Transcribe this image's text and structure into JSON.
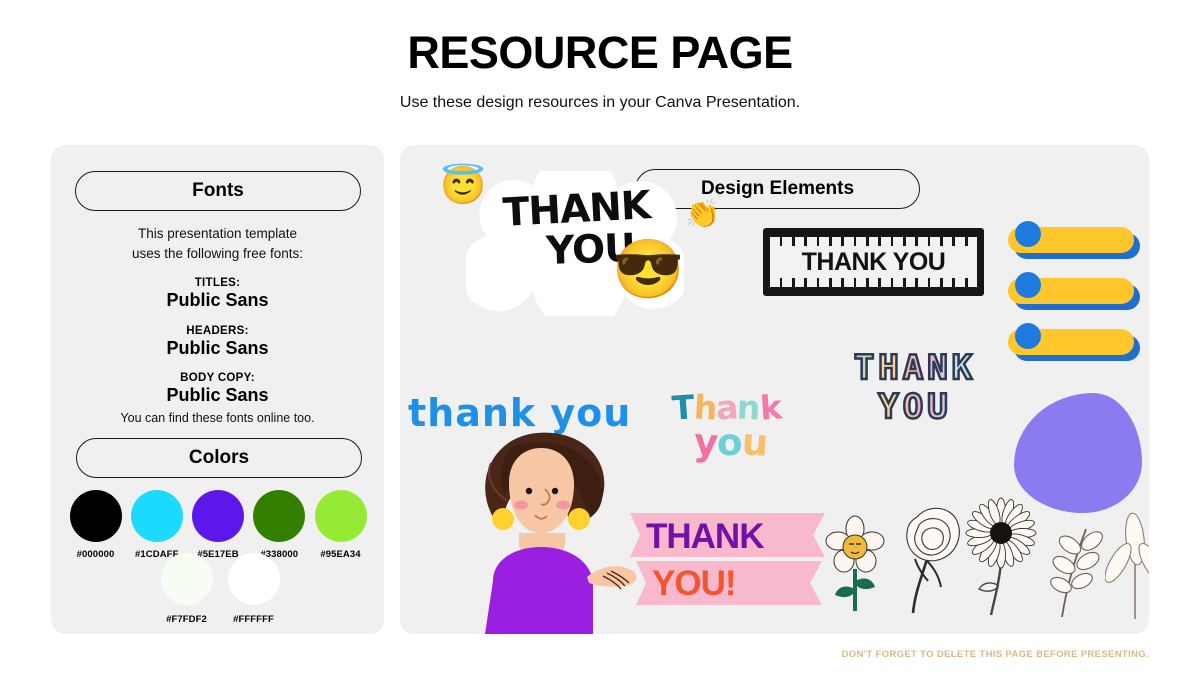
{
  "header": {
    "title": "RESOURCE PAGE",
    "subtitle": "Use these design resources in your Canva Presentation."
  },
  "fonts_panel": {
    "pill_label": "Fonts",
    "intro": "This presentation template\nuses the following free fonts:",
    "groups": [
      {
        "kicker": "TITLES:",
        "font_name": "Public Sans"
      },
      {
        "kicker": "HEADERS:",
        "font_name": "Public Sans"
      },
      {
        "kicker": "BODY COPY:",
        "font_name": "Public Sans"
      }
    ],
    "footer": "You can find these fonts online too."
  },
  "colors_section": {
    "pill_label": "Colors",
    "row1": [
      {
        "hex": "#000000",
        "label": "#000000"
      },
      {
        "hex": "#1CDAFF",
        "label": "#1CDAFF"
      },
      {
        "hex": "#5E17EB",
        "label": "#5E17EB"
      },
      {
        "hex": "#338000",
        "label": "#338000"
      },
      {
        "hex": "#95EA34",
        "label": "#95EA34"
      }
    ],
    "row2": [
      {
        "hex": "#F7FDF2",
        "label": "#F7FDF2"
      },
      {
        "hex": "#FFFFFF",
        "label": "#FFFFFF"
      }
    ]
  },
  "elements_panel": {
    "pill_label": "Design Elements",
    "cloud_sticker": {
      "line1": "THANK",
      "line2": "YOU",
      "emoji_halo": "😇",
      "emoji_clap": "👏",
      "emoji_cool": "😎"
    },
    "film_strip": {
      "text": "THANK YOU"
    },
    "yellow_bars": {
      "count": 3,
      "bar_color": "#FFC72C",
      "dot_color": "#1F7AE0",
      "shadow_color": "#1F6FD0"
    },
    "pixel_text": {
      "line1": "THANK",
      "line2": "YOU"
    },
    "blue_script": {
      "text": "thank you",
      "color": "#1F90E8"
    },
    "pastel_text": {
      "row1": [
        {
          "char": "T",
          "color": "#1D8FA8"
        },
        {
          "char": "h",
          "color": "#F7B45C"
        },
        {
          "char": "a",
          "color": "#F2A8B8"
        },
        {
          "char": "n",
          "color": "#8FD8CF"
        },
        {
          "char": "k",
          "color": "#F27AA8"
        }
      ],
      "row2": [
        {
          "char": "y",
          "color": "#F26FA0"
        },
        {
          "char": "o",
          "color": "#6FCFD8"
        },
        {
          "char": "u",
          "color": "#F5C26B"
        }
      ]
    },
    "purple_blob": {
      "color": "#8A7BF0"
    },
    "banner_text": {
      "word1": "THANK",
      "word2": "YOU!",
      "banner_color": "#F9B9CC",
      "word1_color": "#7210A8",
      "word2_color": "#F4542E"
    },
    "botanicals": [
      {
        "name": "smiling-daisy"
      },
      {
        "name": "peony-outline"
      },
      {
        "name": "daisy-outline"
      },
      {
        "name": "leaf-branch"
      },
      {
        "name": "leaf-sprig"
      }
    ],
    "woman_illustration": {
      "name": "woman-presenting",
      "hair_color": "#4A2618",
      "skin_color": "#F7C6A5",
      "top_color": "#9B1FE0",
      "earring_color": "#FFD12E"
    }
  },
  "footer": {
    "note": "DON'T FORGET TO DELETE THIS PAGE BEFORE PRESENTING."
  }
}
